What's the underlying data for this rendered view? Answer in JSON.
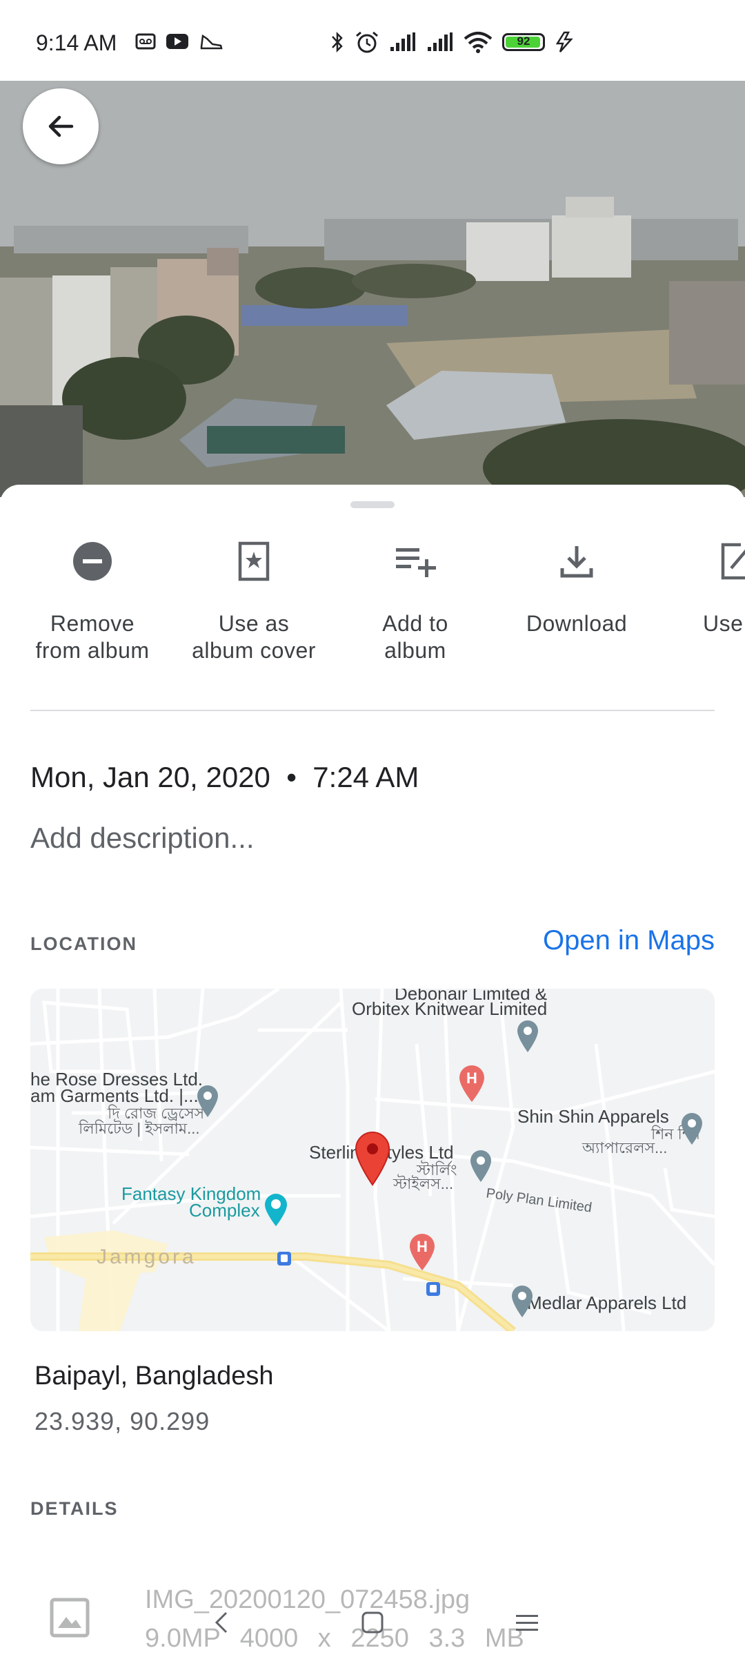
{
  "status_bar": {
    "time": "9:14 AM",
    "battery_level": "92",
    "icons": [
      "voicemail-icon",
      "youtube-icon",
      "shoe-icon",
      "bluetooth-icon",
      "alarm-icon",
      "signal-icon",
      "signal-icon",
      "wifi-icon",
      "battery-icon",
      "charging-icon"
    ]
  },
  "actions": [
    {
      "label_line1": "Remove",
      "label_line2": "from album",
      "icon": "remove-circle-icon"
    },
    {
      "label_line1": "Use as",
      "label_line2": "album cover",
      "icon": "album-cover-icon"
    },
    {
      "label_line1": "Add to",
      "label_line2": "album",
      "icon": "playlist-add-icon"
    },
    {
      "label_line1": "Download",
      "label_line2": "",
      "icon": "download-icon"
    },
    {
      "label_line1": "Use",
      "label_line2": "",
      "icon": "edit-icon"
    }
  ],
  "info": {
    "datetime": "Mon, Jan 20, 2020  •  7:24 AM",
    "description_placeholder": "Add description..."
  },
  "location": {
    "section_label": "LOCATION",
    "open_maps": "Open in Maps",
    "place": "Baipayl, Bangladesh",
    "coords": "23.939, 90.299",
    "map_labels": {
      "debonair": "Debonair Limited &",
      "orbitex": "Orbitex Knitwear Limited",
      "rose1": "he Rose Dresses Ltd.",
      "rose2": "am Garments Ltd. |...",
      "rose3": "দি রোজ ড্রেসেস",
      "rose4": "লিমিটেড | ইসলাম...",
      "shinshin": "Shin Shin Apparels",
      "shinshin_bn1": "শিন শিন",
      "shinshin_bn2": "অ্যাপারেলস...",
      "sterling": "Sterling Styles Ltd",
      "sterling_bn1": "স্টার্লিং",
      "sterling_bn2": "স্টাইলস...",
      "fantasy1": "Fantasy Kingdom",
      "fantasy2": "Complex",
      "polyplan": "Poly Plan Limited",
      "jamgora": "Jamgora",
      "medlar": "Medlar Apparels Ltd"
    }
  },
  "details": {
    "section_label": "DETAILS",
    "file_name": "IMG_20200120_072458.jpg",
    "file_meta": "9.0MP  4000 x 2250  3.3 MB"
  }
}
